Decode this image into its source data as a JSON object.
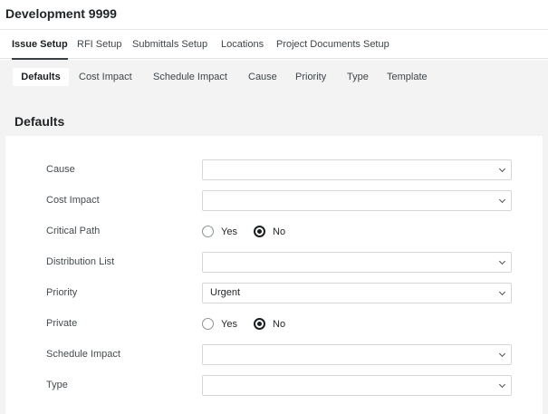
{
  "project": {
    "title": "Development 9999"
  },
  "tabs": [
    {
      "label": "Issue Setup",
      "active": true
    },
    {
      "label": "RFI Setup",
      "active": false
    },
    {
      "label": "Submittals Setup",
      "active": false
    },
    {
      "label": "Locations",
      "active": false
    },
    {
      "label": "Project Documents Setup",
      "active": false
    }
  ],
  "subtabs": [
    {
      "label": "Defaults",
      "active": true
    },
    {
      "label": "Cost Impact",
      "active": false
    },
    {
      "label": "Schedule Impact",
      "active": false
    },
    {
      "label": "Cause",
      "active": false
    },
    {
      "label": "Priority",
      "active": false
    },
    {
      "label": "Type",
      "active": false
    },
    {
      "label": "Template",
      "active": false
    }
  ],
  "panel": {
    "title": "Defaults",
    "fields": {
      "cause": {
        "label": "Cause",
        "value": ""
      },
      "cost_impact": {
        "label": "Cost Impact",
        "value": ""
      },
      "critical_path": {
        "label": "Critical Path",
        "yes_label": "Yes",
        "no_label": "No",
        "selected": "No"
      },
      "distribution_list": {
        "label": "Distribution List",
        "value": ""
      },
      "priority": {
        "label": "Priority",
        "value": "Urgent"
      },
      "private": {
        "label": "Private",
        "yes_label": "Yes",
        "no_label": "No",
        "selected": "No"
      },
      "schedule_impact": {
        "label": "Schedule Impact",
        "value": ""
      },
      "type": {
        "label": "Type",
        "value": ""
      }
    }
  }
}
